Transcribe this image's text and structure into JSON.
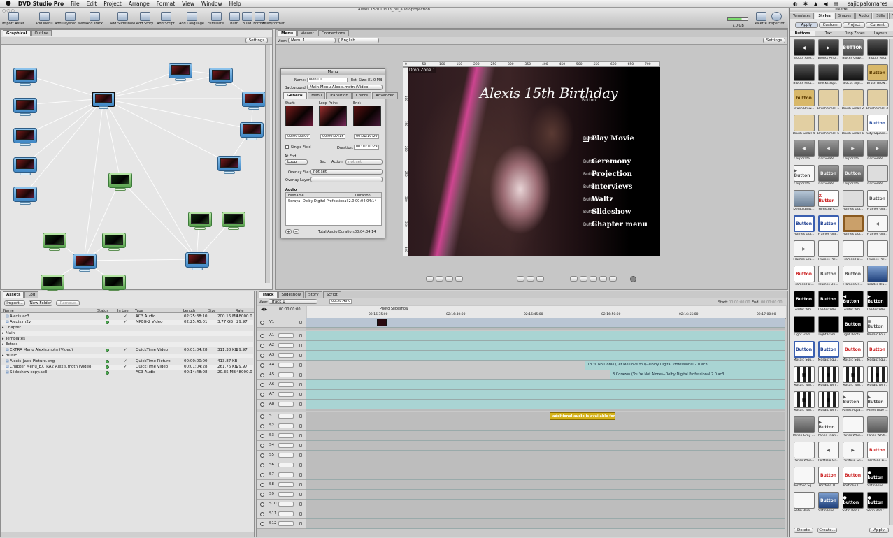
{
  "menubar": {
    "apple": "",
    "app": "DVD Studio Pro",
    "items": [
      "File",
      "Edit",
      "Project",
      "Arrange",
      "Format",
      "View",
      "Window",
      "Help"
    ],
    "user": "sajidpalomares"
  },
  "window_title": "Alexis 15th DVD3_n0_audioprojection",
  "toolbar": {
    "buttons": [
      "Import Asset",
      "Add Menu",
      "Add Layered Menu",
      "Add Track",
      "Add Slideshow",
      "Add Story",
      "Add Script",
      "Add Language",
      "Simulate",
      "Burn",
      "Build",
      "Format",
      "Build/Format"
    ],
    "right": [
      "Palette",
      "Inspector"
    ],
    "disk": "7.0 GB"
  },
  "graph_panel": {
    "tabs": [
      "Graphical",
      "Outline"
    ],
    "settings": "Settings"
  },
  "viewer_panel": {
    "tabs": [
      "Menu",
      "Viewer",
      "Connections"
    ],
    "view_label": "View:",
    "view_value": "Menu 1",
    "language": "English",
    "settings": "Settings"
  },
  "inspector": {
    "title": "Menu",
    "name_label": "Name:",
    "name_value": "Menu 1",
    "size_label": "Est. Size:",
    "size_value": "81.0 MB",
    "bg_label": "Background:",
    "bg_value": "Main Menu Alexis.motn (Video)",
    "tabs": [
      "General",
      "Menu",
      "Transition",
      "Colors",
      "Advanced"
    ],
    "start_label": "Start:",
    "loop_label": "Loop Point:",
    "end_label": "End:",
    "start_tc": "00:00:00:00",
    "loop_tc": "00:00:07:15",
    "end_tc": "00:01:10:29",
    "single_field": "Single Field",
    "duration_label": "Duration:",
    "duration_value": "00:01:10:29",
    "at_end_label": "At End:",
    "at_end_value": "Loop",
    "sec": "Sec",
    "action_label": "Action:",
    "action_value": "not set",
    "overlay_file_label": "Overlay File:",
    "overlay_file_value": "not set",
    "overlay_layer_label": "Overlay Layer:",
    "audio_label": "Audio",
    "audio_cols": [
      "Filename",
      "Duration"
    ],
    "audio_row": [
      "Soraya--Dolby Digital Professional 2.0",
      "00:04:04:14"
    ],
    "total_label": "Total Audio Duration:",
    "total_value": "00:04:04:14"
  },
  "menu_canvas": {
    "drop_zone": "Drop Zone 1",
    "title": "Alexis 15th Birthday",
    "title_button": "Button",
    "items": [
      "Play Movie",
      "Ceremony",
      "Projection",
      "Interviews",
      "Waltz",
      "Slideshow",
      "Chapter menu"
    ],
    "button_label": "Button",
    "ruler_ticks": [
      "0",
      "50",
      "100",
      "150",
      "200",
      "250",
      "300",
      "350",
      "400",
      "450",
      "500",
      "550",
      "600",
      "650",
      "700"
    ],
    "vruler_ticks": [
      "100",
      "150",
      "200",
      "250",
      "300",
      "350",
      "400"
    ]
  },
  "assets": {
    "tabs": [
      "Assets",
      "Log"
    ],
    "buttons": [
      "Import...",
      "New Folder",
      "Remove"
    ],
    "columns": [
      "Name",
      "Status",
      "In Use",
      "Type",
      "Length",
      "Size",
      "Rate"
    ],
    "rows": [
      {
        "name": "Alexis.ac3",
        "status": true,
        "inuse": "✓",
        "type": "AC3 Audio",
        "length": "02:25:38:10",
        "size": "200.16 MB",
        "rate": "48000.0"
      },
      {
        "name": "Alexis.m2v",
        "status": true,
        "inuse": "✓",
        "type": "MPEG-2 Video",
        "length": "02:25:45:01",
        "size": "3.77 GB",
        "rate": "29.97"
      },
      {
        "name": "Chapter",
        "status": false,
        "inuse": "",
        "type": "",
        "length": "",
        "size": "",
        "rate": ""
      },
      {
        "name": "Main",
        "status": false,
        "inuse": "",
        "type": "",
        "length": "",
        "size": "",
        "rate": ""
      },
      {
        "name": "Templates",
        "status": false,
        "inuse": "",
        "type": "",
        "length": "",
        "size": "",
        "rate": ""
      },
      {
        "name": "Extras",
        "status": false,
        "inuse": "",
        "type": "",
        "length": "",
        "size": "",
        "rate": ""
      },
      {
        "name": "EXTRA Menu Alexis.motn (Video)",
        "status": true,
        "inuse": "✓",
        "type": "QuickTime Video",
        "length": "00:01:04:28",
        "size": "311.38 KB",
        "rate": "29.97"
      },
      {
        "name": "music",
        "status": false,
        "inuse": "",
        "type": "",
        "length": "",
        "size": "",
        "rate": ""
      },
      {
        "name": "Alexis_Jack_Picture.png",
        "status": true,
        "inuse": "✓",
        "type": "QuickTime Picture",
        "length": "00:00:00:00",
        "size": "413.87 KB",
        "rate": ""
      },
      {
        "name": "Chapter Menu_EXTRA2 Alexis.motn (Video)",
        "status": true,
        "inuse": "✓",
        "type": "QuickTime Video",
        "length": "00:01:04:28",
        "size": "261.76 KB",
        "rate": "29.97"
      },
      {
        "name": "Slideshow copy.ac3",
        "status": true,
        "inuse": "",
        "type": "AC3 Audio",
        "length": "00:14:48:08",
        "size": "20.35 MB",
        "rate": "48000.0"
      }
    ]
  },
  "timeline": {
    "tabs": [
      "Track",
      "Slideshow",
      "Story",
      "Script"
    ],
    "view_label": "View:",
    "view_value": "Track 1",
    "timecode": "00:58:46:07",
    "start_label": "Start:",
    "start_value": "00:00:00:00",
    "end_label": "End:",
    "end_value": "00:00:00:00",
    "playhead_tc": "00:00:00:00",
    "marker": "Photo Slideshow",
    "ticks": [
      "02:16:35:00",
      "02:16:40:00",
      "02:16:45:00",
      "02:16:50:00",
      "02:16:55:00",
      "02:17:00:00"
    ],
    "video_tracks": [
      "V1"
    ],
    "audio_tracks": [
      "A1",
      "A2",
      "A3",
      "A4",
      "A5",
      "A6",
      "A7",
      "A8"
    ],
    "sub_tracks": [
      "S1",
      "S2",
      "S3",
      "S4",
      "S5",
      "S6",
      "S7",
      "S8",
      "S9",
      "S10",
      "S11",
      "S12"
    ],
    "clip_a4": "13 Ya No Lloras (Let Me Love You)--Dolby Digital Professional 2.0.ac3",
    "clip_a5": "3 Corazón (You're Not Alone)--Dolby Digital Professional 2.0.ac3",
    "clip_s1": "additional audio is available for slid..."
  },
  "palette": {
    "title": "Palette",
    "tabs": [
      "Templates",
      "Styles",
      "Shapes",
      "Audio",
      "Stills",
      "Video"
    ],
    "subtabs": [
      "Apply",
      "Custom",
      "Project",
      "Current"
    ],
    "cats": [
      "Buttons",
      "Text",
      "Drop Zones",
      "Layouts"
    ],
    "items": [
      {
        "t": "◀",
        "l": "Blocks Arro...",
        "s": "dark"
      },
      {
        "t": "▶",
        "l": "Blocks Arro...",
        "s": "dark"
      },
      {
        "t": "BUTTON",
        "l": "Blocks Gray...",
        "s": "gray"
      },
      {
        "t": "",
        "l": "Blocks Rect",
        "s": "dark"
      },
      {
        "t": "",
        "l": "Blocks Rect...",
        "s": "dark"
      },
      {
        "t": "",
        "l": "Blocks Squ...",
        "s": "dark"
      },
      {
        "t": "",
        "l": "Blocks Squ...",
        "s": "dark"
      },
      {
        "t": "Button",
        "l": "Brush Brow...",
        "s": "tan"
      },
      {
        "t": "button",
        "l": "Brush Brow...",
        "s": "tan"
      },
      {
        "t": "",
        "l": "Brush Small 1",
        "s": "tan2"
      },
      {
        "t": "",
        "l": "Brush Small 2",
        "s": "tan2"
      },
      {
        "t": "",
        "l": "Brush Small 3",
        "s": "tan2"
      },
      {
        "t": "",
        "l": "Brush Small 4",
        "s": "tan2"
      },
      {
        "t": "",
        "l": "Brush Small 5",
        "s": "tan2"
      },
      {
        "t": "",
        "l": "Brush Small 6",
        "s": "tan2"
      },
      {
        "t": "Button",
        "l": "City Square...",
        "s": "blue"
      },
      {
        "t": "◀",
        "l": "Corporate ...",
        "s": "slate"
      },
      {
        "t": "◀",
        "l": "Corporate ...",
        "s": "slate"
      },
      {
        "t": "▶",
        "l": "Corporate ...",
        "s": "slate"
      },
      {
        "t": "▶",
        "l": "Corporate ...",
        "s": "slate"
      },
      {
        "t": "▶ Button",
        "l": "Corporate ...",
        "s": "white"
      },
      {
        "t": "Button",
        "l": "Corporate ...",
        "s": "slate"
      },
      {
        "t": "Button",
        "l": "Corporate ...",
        "s": "slate"
      },
      {
        "t": "",
        "l": "Corporate ...",
        "s": "light"
      },
      {
        "t": "",
        "l": "DefaultButt...",
        "s": "steel"
      },
      {
        "t": "X Button",
        "l": "Filmstrip C...",
        "s": "red"
      },
      {
        "t": "",
        "l": "Frames Gla...",
        "s": "light"
      },
      {
        "t": "Button",
        "l": "Frames Gla...",
        "s": "white"
      },
      {
        "t": "Button",
        "l": "Frames Gla...",
        "s": "blue2"
      },
      {
        "t": "Button",
        "l": "Frames Gla...",
        "s": "blue2"
      },
      {
        "t": "",
        "l": "Frames Gol...",
        "s": "gold"
      },
      {
        "t": "◀",
        "l": "Frames Gla...",
        "s": "white"
      },
      {
        "t": "▶",
        "l": "Frames Gra...",
        "s": "white"
      },
      {
        "t": "",
        "l": "Frames Pol...",
        "s": "white"
      },
      {
        "t": "",
        "l": "Frames Pol...",
        "s": "white"
      },
      {
        "t": "",
        "l": "Frames Pol...",
        "s": "white"
      },
      {
        "t": "Button",
        "l": "Frames Pol...",
        "s": "red"
      },
      {
        "t": "Button",
        "l": "Frames Un...",
        "s": "white"
      },
      {
        "t": "Button",
        "l": "Frames Un...",
        "s": "white"
      },
      {
        "t": "",
        "l": "Leader Blu...",
        "s": "blue3"
      },
      {
        "t": "Button",
        "l": "Leader Whi...",
        "s": "black"
      },
      {
        "t": "Button",
        "l": "Leader Whi...",
        "s": "black"
      },
      {
        "t": "◀ Button",
        "l": "Leader Whi...",
        "s": "black"
      },
      {
        "t": "▶ Button",
        "l": "Leader Whi...",
        "s": "black"
      },
      {
        "t": "",
        "l": "Light Fram...",
        "s": "black"
      },
      {
        "t": "",
        "l": "Light Fram...",
        "s": "black"
      },
      {
        "t": "Button",
        "l": "Light Recta...",
        "s": "black"
      },
      {
        "t": "▦ Button",
        "l": "Mosaic Fou...",
        "s": "white"
      },
      {
        "t": "Button",
        "l": "Mosaic Squ...",
        "s": "blue2"
      },
      {
        "t": "Button",
        "l": "Mosaic Squ...",
        "s": "blue2"
      },
      {
        "t": "Button",
        "l": "Mosaic Squ...",
        "s": "red"
      },
      {
        "t": "Button",
        "l": "Mosaic Squ...",
        "s": "red"
      },
      {
        "t": "▦",
        "l": "Mosaic Win...",
        "s": "mosaic"
      },
      {
        "t": "▦",
        "l": "Mosaic Win...",
        "s": "mosaic"
      },
      {
        "t": "▦",
        "l": "Mosaic Win...",
        "s": "mosaic"
      },
      {
        "t": "▦",
        "l": "Mosaic Win...",
        "s": "mosaic"
      },
      {
        "t": "▦",
        "l": "Mosaic Win...",
        "s": "mosaic"
      },
      {
        "t": "▦",
        "l": "Mosaic Win...",
        "s": "mosaic"
      },
      {
        "t": "▶ Button",
        "l": "Panes Aqua...",
        "s": "white"
      },
      {
        "t": "▶ Button",
        "l": "Panes Blue ...",
        "s": "white"
      },
      {
        "t": "",
        "l": "Panes Gray ...",
        "s": "slate"
      },
      {
        "t": "▶ Button",
        "l": "Panes Trian...",
        "s": "white"
      },
      {
        "t": "",
        "l": "Panes Whit...",
        "s": "white"
      },
      {
        "t": "",
        "l": "Panes Whit...",
        "s": "slate"
      },
      {
        "t": "",
        "l": "Panes Whit...",
        "s": "white"
      },
      {
        "t": "◀",
        "l": "Portfolio Gr...",
        "s": "white"
      },
      {
        "t": "▶",
        "l": "Portfolio Gr...",
        "s": "white"
      },
      {
        "t": "Button",
        "l": "Portfolio Li...",
        "s": "red"
      },
      {
        "t": "",
        "l": "Portfolio Sq...",
        "s": "white"
      },
      {
        "t": "Button",
        "l": "Portfolio U...",
        "s": "red"
      },
      {
        "t": "Button",
        "l": "Portfolio U...",
        "s": "red"
      },
      {
        "t": "● button",
        "l": "Satin Blue ...",
        "s": "black"
      },
      {
        "t": "",
        "l": "Satin Blue ...",
        "s": "white"
      },
      {
        "t": "Button",
        "l": "Satin Blue ...",
        "s": "blue3"
      },
      {
        "t": "● button",
        "l": "Satin Red C...",
        "s": "black"
      },
      {
        "t": "● button",
        "l": "Satin Red C...",
        "s": "black"
      }
    ],
    "footer": [
      "Delete",
      "Create...",
      "Apply"
    ]
  }
}
